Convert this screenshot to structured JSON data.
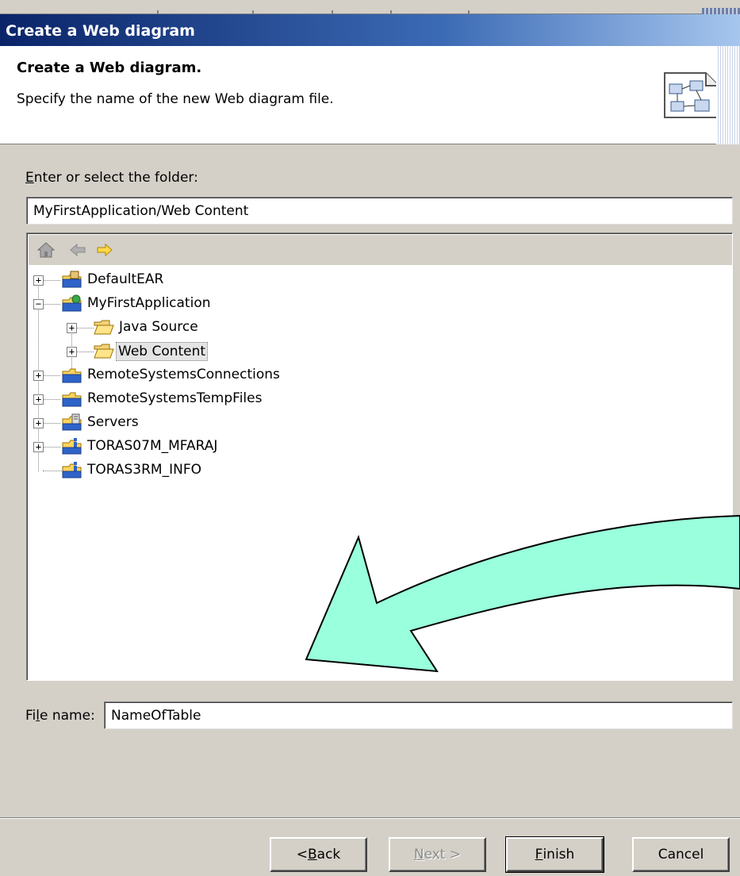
{
  "window": {
    "title": "Create a Web diagram"
  },
  "banner": {
    "heading": "Create a Web diagram.",
    "description": "Specify the name of the new Web diagram file."
  },
  "folder": {
    "label_prefix": "E",
    "label_rest": "nter or select the folder:",
    "value": "MyFirstApplication/Web Content"
  },
  "tree": {
    "toolbar": [
      "home-icon",
      "back-arrow-icon",
      "forward-arrow-icon"
    ],
    "items": [
      {
        "label": "DefaultEAR",
        "expander": "+",
        "icon": "project-folder-icon"
      },
      {
        "label": "MyFirstApplication",
        "expander": "−",
        "icon": "web-project-folder-icon"
      },
      {
        "label": "Java Source",
        "expander": "+",
        "icon": "open-folder-icon"
      },
      {
        "label": "Web Content",
        "expander": "+",
        "icon": "open-folder-icon",
        "selected": true
      },
      {
        "label": "RemoteSystemsConnections",
        "expander": "+",
        "icon": "project-folder-icon"
      },
      {
        "label": "RemoteSystemsTempFiles",
        "expander": "+",
        "icon": "project-folder-icon"
      },
      {
        "label": "Servers",
        "expander": "+",
        "icon": "server-folder-icon"
      },
      {
        "label": "TORAS07M_MFARAJ",
        "expander": "+",
        "icon": "java-project-folder-icon"
      },
      {
        "label": "TORAS3RM_INFO",
        "expander": "",
        "icon": "java-project-folder-icon"
      }
    ]
  },
  "file": {
    "label_pre": "Fi",
    "label_u": "l",
    "label_post": "e name:",
    "value": "NameOfTable"
  },
  "buttons": {
    "back": {
      "pre": "< ",
      "u": "B",
      "post": "ack"
    },
    "next": {
      "pre": "",
      "u": "N",
      "post": "ext >"
    },
    "finish": {
      "pre": "",
      "u": "F",
      "post": "inish"
    },
    "cancel": "Cancel"
  },
  "colors": {
    "arrow_fill": "#99ffdd",
    "title_start": "#0a2469",
    "title_end": "#a6c6ee",
    "dialog_bg": "#d4d0c8"
  }
}
